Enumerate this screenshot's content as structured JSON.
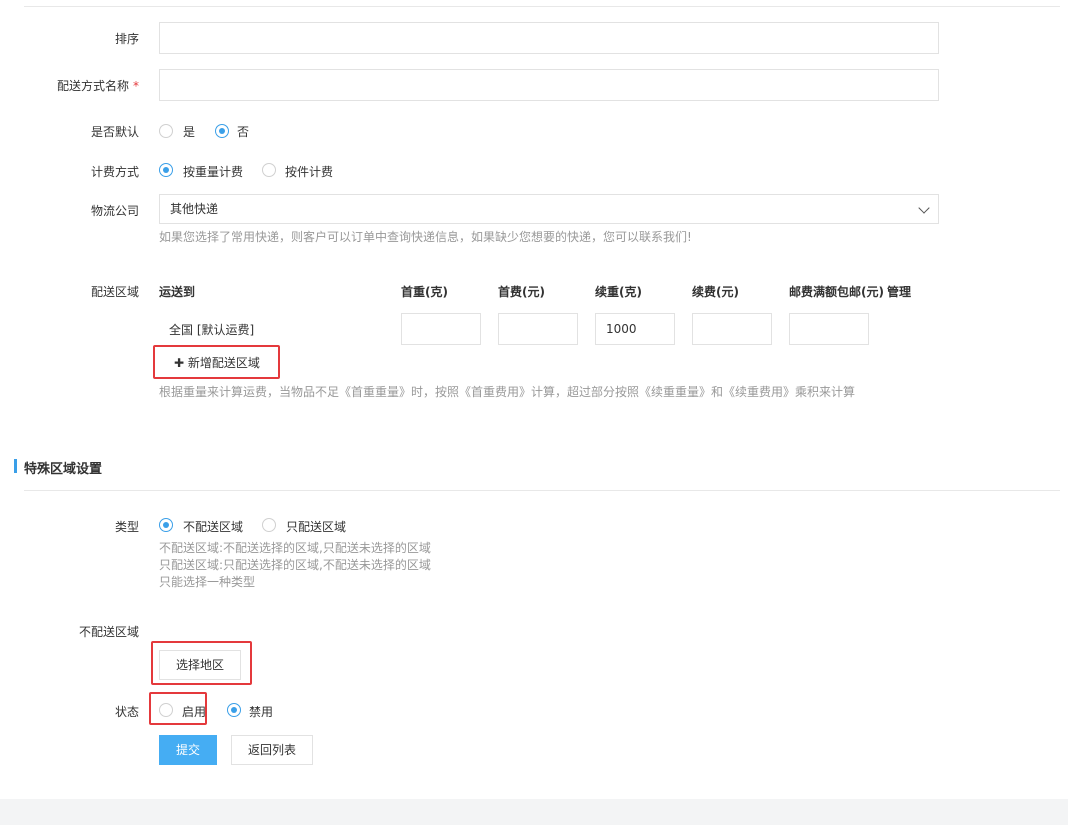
{
  "form": {
    "sort_label": "排序",
    "sort_value": "",
    "name_label": "配送方式名称",
    "required_mark": "*",
    "name_value": "",
    "default_label": "是否默认",
    "default_options": [
      "是",
      "否"
    ],
    "default_selected": "否",
    "billing_label": "计费方式",
    "billing_options": [
      "按重量计费",
      "按件计费"
    ],
    "billing_selected": "按重量计费",
    "logistics_label": "物流公司",
    "logistics_selected": "其他快递",
    "logistics_help": "如果您选择了常用快递，则客户可以订单中查询快递信息，如果缺少您想要的快递，您可以联系我们!"
  },
  "region_table": {
    "label": "配送区域",
    "headers": [
      "运送到",
      "首重(克)",
      "首费(元)",
      "续重(克)",
      "续费(元)",
      "邮费满额包邮(元)",
      "管理"
    ],
    "rows": [
      {
        "region": "全国 [默认运费]",
        "first_weight": "",
        "first_fee": "",
        "extra_weight": "1000",
        "extra_fee": "",
        "free_threshold": ""
      }
    ],
    "add_button": "新增配送区域",
    "help": "根据重量来计算运费，当物品不足《首重重量》时，按照《首重费用》计算，超过部分按照《续重重量》和《续重费用》乘积来计算"
  },
  "special": {
    "section_title": "特殊区域设置",
    "type_label": "类型",
    "type_options": [
      "不配送区域",
      "只配送区域"
    ],
    "type_selected": "不配送区域",
    "type_help": [
      "不配送区域:不配送选择的区域,只配送未选择的区域",
      "只配送区域:只配送选择的区域,不配送未选择的区域",
      "只能选择一种类型"
    ],
    "no_delivery_label": "不配送区域",
    "select_region_button": "选择地区",
    "status_label": "状态",
    "status_options": [
      "启用",
      "禁用"
    ],
    "status_selected": "禁用"
  },
  "actions": {
    "submit": "提交",
    "back": "返回列表"
  },
  "colors": {
    "accent": "#3a9fe8",
    "primary_button": "#45adf3",
    "highlight": "#e4393c"
  }
}
